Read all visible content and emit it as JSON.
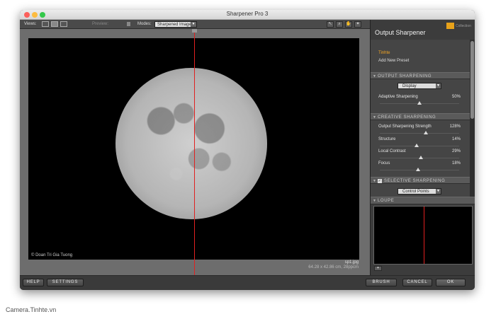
{
  "window": {
    "title": "Sharpener Pro 3"
  },
  "toolbar": {
    "views_label": "Views:",
    "preview_label": "Preview:",
    "modes_label": "Modes:",
    "mode_value": "Sharpened Image",
    "tools": [
      "arrow-tool-icon",
      "zoom-tool-icon",
      "hand-tool-icon",
      "pin-tool-icon"
    ]
  },
  "image": {
    "copyright": "© Doan Tri Gia Tuong",
    "filename": "sp1.jpg",
    "dimensions": "64.28 x 42.86 cm, 28ppcm"
  },
  "panel": {
    "title": "Output Sharpener",
    "logo_text": "Collection",
    "presets": [
      {
        "label": "Tinhte",
        "active": true
      },
      {
        "label": "Add New Preset",
        "active": false
      }
    ],
    "output_sharpening": {
      "header": "OUTPUT SHARPENING",
      "dropdown": "Display",
      "sliders": [
        {
          "label": "Adaptive Sharpening",
          "value": "50%",
          "level": 50
        }
      ]
    },
    "creative_sharpening": {
      "header": "CREATIVE SHARPENING",
      "sliders": [
        {
          "label": "Output Sharpening Strength",
          "value": "128%",
          "level": 58
        },
        {
          "label": "Structure",
          "value": "14%",
          "level": 46
        },
        {
          "label": "Local Contrast",
          "value": "29%",
          "level": 52
        },
        {
          "label": "Focus",
          "value": "18%",
          "level": 48
        }
      ]
    },
    "selective_sharpening": {
      "header": "SELECTIVE SHARPENING",
      "checked": true,
      "dropdown": "Control Points"
    },
    "loupe": {
      "header": "LOUPE"
    }
  },
  "buttons": {
    "help": "HELP",
    "settings": "SETTINGS",
    "brush": "BRUSH",
    "cancel": "CANCEL",
    "ok": "OK"
  },
  "watermark": "Camera.Tinhte.vn",
  "colors": {
    "accent_preset": "#f5a623",
    "split_line": "#e02020",
    "logo": "#e8a21a"
  }
}
